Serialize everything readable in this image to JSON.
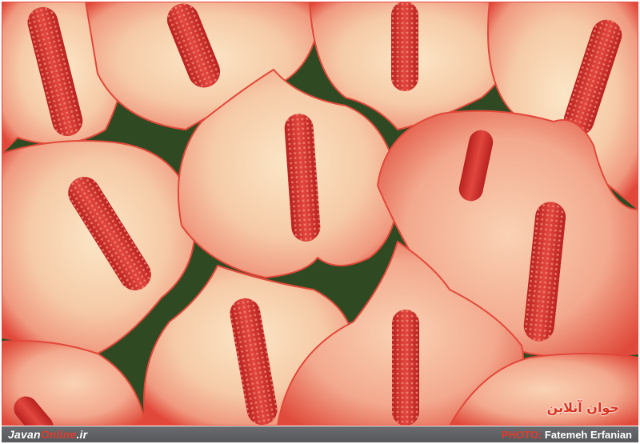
{
  "photo": {
    "subject": "anthurium-flowers",
    "colors": {
      "spathe_light": "#f7d9b4",
      "spathe_mid": "#f2b59a",
      "spathe_edge": "#e2483a",
      "spadix": "#d3322e",
      "foliage": "#2f4a22"
    }
  },
  "watermark": {
    "text": "جوان آنلاین"
  },
  "footer": {
    "brand_part1": "Javan",
    "brand_part2": "Online",
    "brand_part3": ".ir",
    "credit_label": "PHOTO:",
    "credit_name": "Fatemeh Erfanian"
  }
}
